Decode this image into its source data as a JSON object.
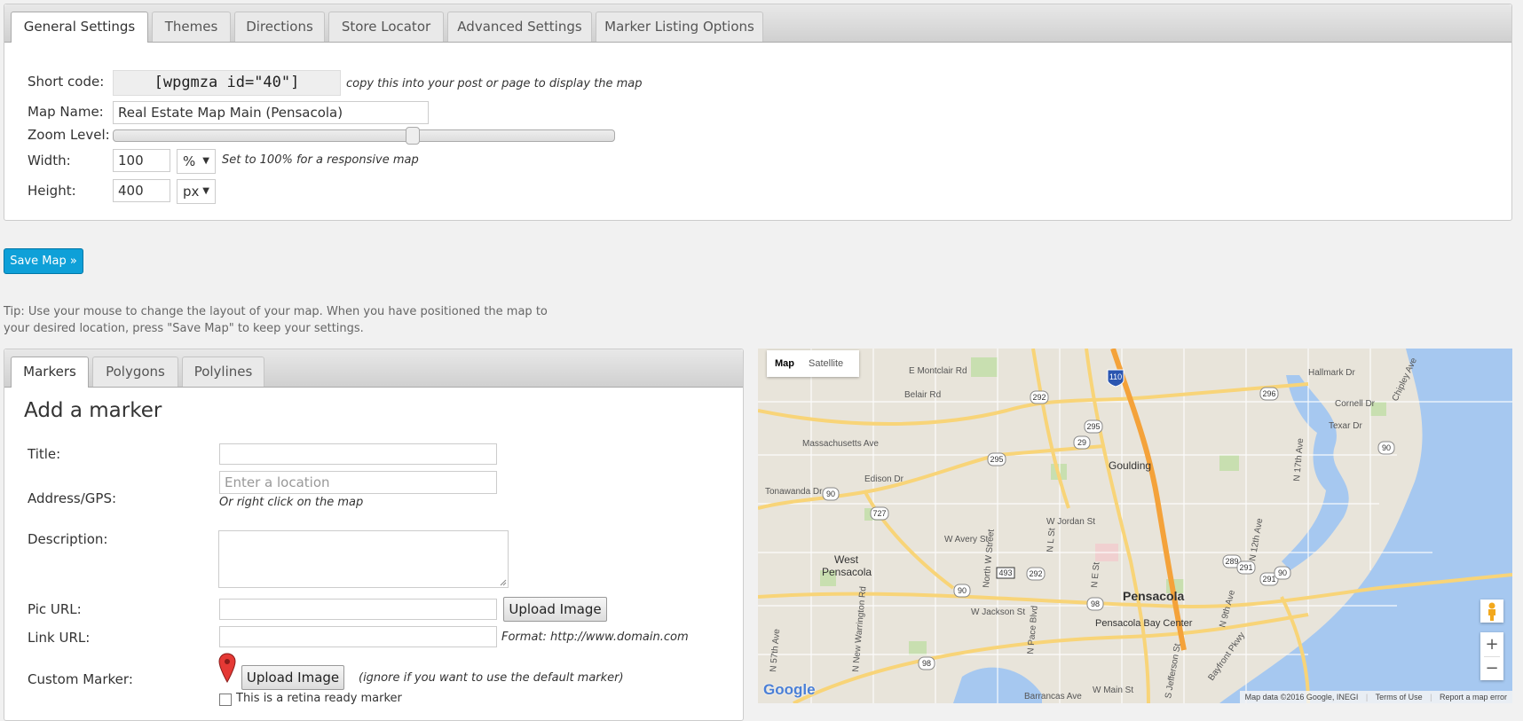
{
  "settings_tabs": [
    "General Settings",
    "Themes",
    "Directions",
    "Store Locator",
    "Advanced Settings",
    "Marker Listing Options"
  ],
  "general": {
    "shortcode_label": "Short code:",
    "shortcode_value": "[wpgmza id=\"40\"]",
    "shortcode_hint": "copy this into your post or page to display the map",
    "map_name_label": "Map Name:",
    "map_name_value": "Real Estate Map Main (Pensacola)",
    "zoom_label": "Zoom Level:",
    "zoom_level": 0.6,
    "width_label": "Width:",
    "width_value": "100",
    "width_unit": "%",
    "width_hint": "Set to 100% for a responsive map",
    "height_label": "Height:",
    "height_value": "400",
    "height_unit": "px"
  },
  "save_label": "Save Map »",
  "tip": "Tip: Use your mouse to change the layout of your map. When you have positioned the map to your desired location, press \"Save Map\" to keep your settings.",
  "marker_tabs": [
    "Markers",
    "Polygons",
    "Polylines"
  ],
  "marker_form": {
    "heading": "Add a marker",
    "title_label": "Title:",
    "title_value": "",
    "address_label": "Address/GPS:",
    "address_placeholder": "Enter a location",
    "address_hint": "Or right click on the map",
    "description_label": "Description:",
    "pic_label": "Pic URL:",
    "upload_label": "Upload Image",
    "link_label": "Link URL:",
    "link_hint": "Format: http://www.domain.com",
    "custom_marker_label": "Custom Marker:",
    "custom_marker_hint": "(ignore if you want to use the default marker)",
    "retina_label": "This is a retina ready marker"
  },
  "map": {
    "type_buttons": [
      "Map",
      "Satellite"
    ],
    "labels": {
      "goulding": "Goulding",
      "west_pensacola": "West\nPensacola",
      "pensacola": "Pensacola",
      "pensacola_bay_center": "Pensacola Bay Center",
      "massachusetts": "Massachusetts Ave",
      "montclair": "E Montclair Rd",
      "belair": "Belair Rd",
      "edison": "Edison Dr",
      "tonawanda": "Tonawanda Dr",
      "avery": "W Avery St",
      "jordan": "W Jordan St",
      "jackson": "W Jackson St",
      "main": "W Main St",
      "barrancas": "Barrancas Ave",
      "texar": "Texar Dr",
      "hallmark": "Hallmark Dr",
      "cornell": "Cornell Dr",
      "chipley": "Chipley Ave",
      "ninth": "N 9th Ave",
      "twelfth": "N 12th Ave",
      "seventeenth": "N 17th Ave",
      "pace": "N Pace Blvd",
      "warrington": "N New Warrington Rd",
      "fiftyseventh": "N 57th Ave",
      "north_w": "North W Street",
      "ne_st": "N E St",
      "nl_st": "N L St",
      "s_jefferson": "S Jefferson St",
      "bayfront": "Bayfront Pkwy"
    },
    "shields": [
      "110",
      "292",
      "295",
      "29",
      "295",
      "296",
      "90",
      "90",
      "727",
      "493",
      "292",
      "291",
      "289",
      "90",
      "98",
      "98",
      "90",
      "291"
    ],
    "footer": [
      "Map data ©2016 Google, INEGI",
      "Terms of Use",
      "Report a map error"
    ],
    "google_logo": "Google"
  }
}
